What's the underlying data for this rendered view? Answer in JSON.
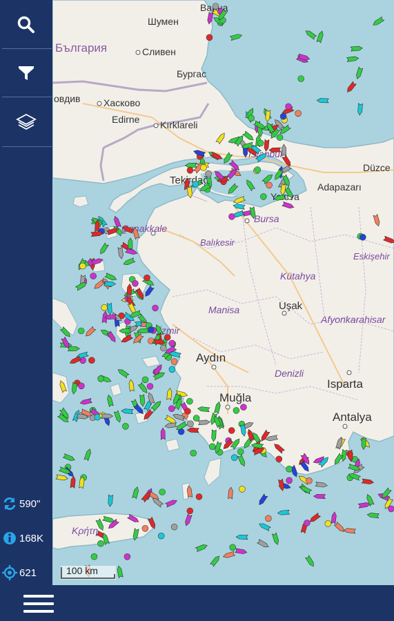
{
  "colors": {
    "sea": "#aad3df",
    "land": "#f2efe9",
    "border": "#9e8cb5",
    "road": "#f4c98d",
    "coast": "#8fb9c8",
    "sidebar": "#1c3366",
    "accent": "#2aa4e8"
  },
  "toolbar": {
    "search_icon": "search-icon",
    "filter_icon": "filter-icon",
    "layers_icon": "layers-icon"
  },
  "stats": {
    "refresh": "590\"",
    "info": "168K",
    "target": "621"
  },
  "scale": {
    "label": "100 km"
  },
  "places": {
    "varna": "Варна",
    "shumen": "Шумен",
    "bulgaria": "България",
    "sliven": "Сливен",
    "burgas": "Бургас",
    "plovdiv": "овдив",
    "haskovo": "Хасково",
    "edirne": "Edirne",
    "kirklareli": "Kırklareli",
    "istanbul": "İstanbul",
    "tekirdag": "Tekirdağ",
    "duzce": "Düzce",
    "adapazari": "Adapazarı",
    "yalova": "Yalova",
    "bursa": "Bursa",
    "canakkale": "Çanakkale",
    "balikesir": "Balıkesir",
    "eskisehir": "Eskişehir",
    "kutahya": "Kütahya",
    "manisa": "Manisa",
    "usak": "Uşak",
    "afyon": "Afyonkarahisar",
    "izmir": "İzmir",
    "aydin": "Aydın",
    "denizli": "Denizli",
    "isparta": "Isparta",
    "mugla": "Muğla",
    "antalya": "Antalya",
    "kriti": "Κρήτη"
  }
}
